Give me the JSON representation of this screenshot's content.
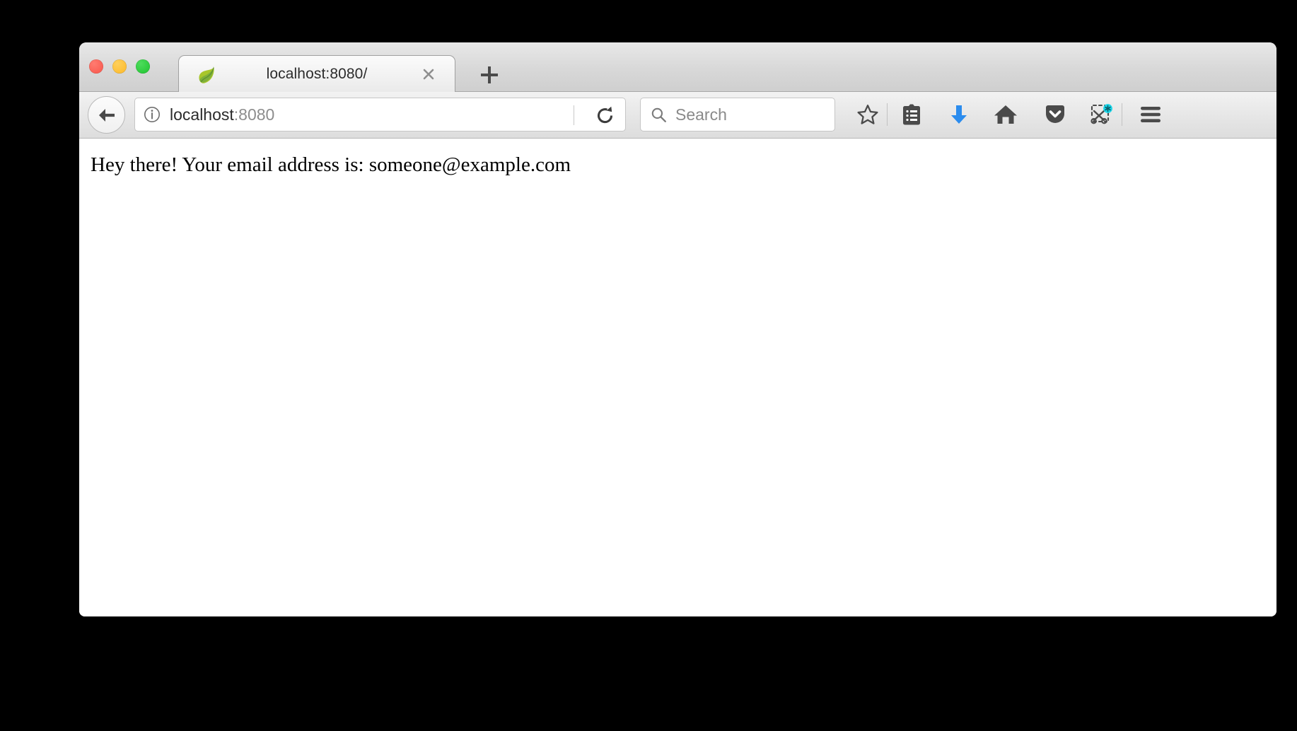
{
  "window": {
    "title_bar_controls": [
      {
        "name": "close",
        "color": "#f8564b"
      },
      {
        "name": "minimize",
        "color": "#fcb827"
      },
      {
        "name": "maximize",
        "color": "#1fc32f"
      }
    ]
  },
  "tabs": {
    "active_tab": {
      "title": "localhost:8080/",
      "favicon": "spring-leaf-icon",
      "close_label": "×"
    },
    "new_tab_label": "+"
  },
  "toolbar": {
    "back_icon": "back-arrow-icon",
    "identity_icon": "info-icon",
    "url_prefix": "localhost",
    "url_suffix": ":8080",
    "reload_icon": "reload-icon",
    "search_placeholder": "Search",
    "search_icon": "search-icon",
    "icons": [
      {
        "name": "bookmark-star-icon",
        "label": "Bookmark"
      },
      {
        "name": "library-icon",
        "label": "Library"
      },
      {
        "name": "downloads-icon",
        "label": "Downloads",
        "color": "#2b8cee"
      },
      {
        "name": "home-icon",
        "label": "Home"
      },
      {
        "name": "pocket-icon",
        "label": "Save to Pocket"
      },
      {
        "name": "screenshot-icon",
        "label": "Take a Screenshot",
        "badge_color": "#1ad5e8"
      },
      {
        "name": "menu-icon",
        "label": "Open menu"
      }
    ]
  },
  "page": {
    "body_text": "Hey there! Your email address is: someone@example.com"
  },
  "colors": {
    "background": "#000000",
    "chrome_light": "#f2f2f2",
    "chrome_dark": "#cfcfcf",
    "icon_dark": "#4a4a4a",
    "accent_blue": "#2b8cee",
    "badge_cyan": "#1ad5e8"
  }
}
